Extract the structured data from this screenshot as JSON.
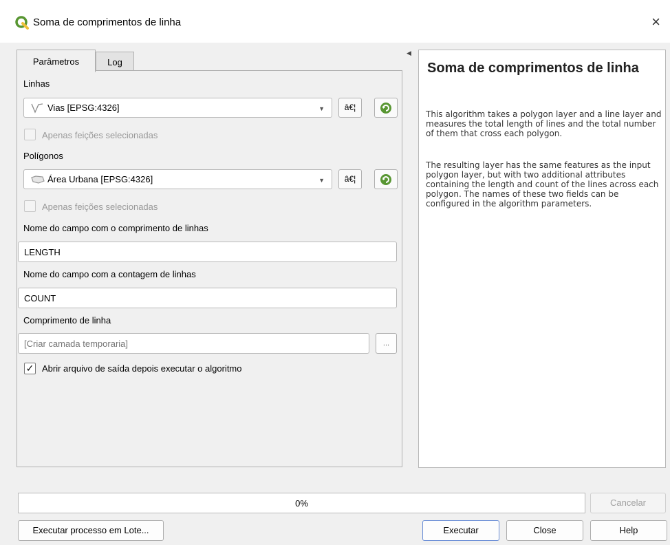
{
  "window": {
    "title": "Soma de comprimentos de linha",
    "close_glyph": "×"
  },
  "tabs": [
    {
      "label": "Parâmetros",
      "active": true
    },
    {
      "label": "Log",
      "active": false
    }
  ],
  "params": {
    "lines_label": "Linhas",
    "lines_value": "Vias [EPSG:4326]",
    "lines_selected_only": "Apenas feições selecionadas",
    "polygons_label": "Polígonos",
    "polygons_value": "Área Urbana [EPSG:4326]",
    "polygons_selected_only": "Apenas feições selecionadas",
    "iterate_button_label": "â€¦",
    "length_field_label": "Nome do campo com o comprimento de linhas",
    "length_field_value": "LENGTH",
    "count_field_label": "Nome do campo com a contagem de linhas",
    "count_field_value": "COUNT",
    "output_label": "Comprimento de linha",
    "output_placeholder": "[Criar camada temporaria]",
    "browse_label": "...",
    "open_output_label": "Abrir arquivo de saída depois executar o algoritmo",
    "open_output_checked": true
  },
  "help": {
    "title": "Soma de comprimentos de linha",
    "paragraph1": "This algorithm takes a polygon layer and a line layer and measures the total length of lines and the total number of them that cross each polygon.",
    "paragraph2": "The resulting layer has the same features as the input polygon layer, but with two additional attributes containing the length and count of the lines across each polygon. The names of these two fields can be configured in the algorithm parameters."
  },
  "progress": {
    "value": 0,
    "text": "0%",
    "fill_color": "#06b025"
  },
  "buttons": {
    "cancel": "Cancelar",
    "batch": "Executar processo em Lote...",
    "run": "Executar",
    "close": "Close",
    "help": "Help"
  },
  "colors": {
    "qgis_green": "#589632",
    "qgis_yellow": "#f0c03a"
  }
}
